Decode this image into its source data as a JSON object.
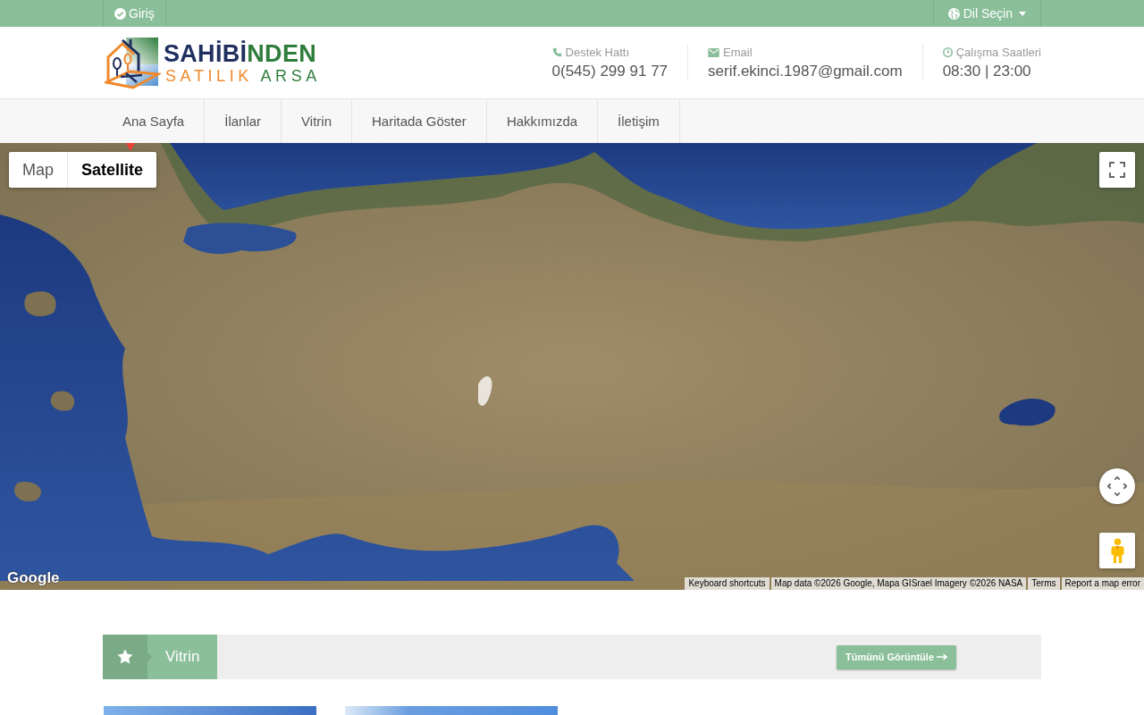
{
  "top_bar": {
    "login": {
      "label": "Giriş"
    },
    "language": {
      "label": "Dil Seçin"
    }
  },
  "header": {
    "logo": {
      "title": [
        {
          "text": "SAHİBİ",
          "color": "#1f2f5e"
        },
        {
          "text": "NDEN",
          "color": "#2f7d3c"
        }
      ],
      "subtitle": [
        {
          "text": "SATILIK",
          "color": "#f0892b"
        },
        {
          "text": "ARSA",
          "color": "#2f7d3c"
        }
      ]
    },
    "contacts": [
      {
        "kind": "phone",
        "label": "Destek Hattı",
        "value": "0(545) 299 91 77"
      },
      {
        "kind": "email",
        "label": "Email",
        "value": "serif.ekinci.1987@gmail.com"
      },
      {
        "kind": "clock",
        "label": "Çalışma Saatleri",
        "value": "08:30 | 23:00"
      }
    ]
  },
  "nav": {
    "items": [
      {
        "label": "Ana Sayfa"
      },
      {
        "label": "İlanlar"
      },
      {
        "label": "Vitrin"
      },
      {
        "label": "Haritada Göster"
      },
      {
        "label": "Hakkımızda"
      },
      {
        "label": "İletişim"
      }
    ]
  },
  "map": {
    "type_control": [
      {
        "label": "Map",
        "selected": false
      },
      {
        "label": "Satellite",
        "selected": true
      }
    ],
    "logo": "Google",
    "attribution": {
      "shortcuts": "Keyboard shortcuts",
      "data": "Map data ©2026 Google, Mapa GISrael Imagery ©2026 NASA",
      "terms": "Terms",
      "report": "Report a map error"
    }
  },
  "showcase": {
    "title": "Vitrin",
    "button": "Tümünü Görüntüle",
    "cards": [
      {
        "kind": "photo"
      },
      {
        "kind": "photo"
      }
    ]
  }
}
